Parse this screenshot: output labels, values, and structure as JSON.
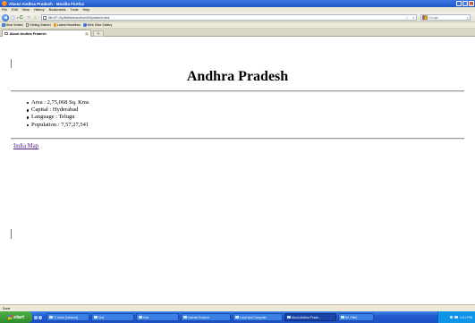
{
  "window": {
    "title": "About Andhra Pradesh - Mozilla Firefox",
    "minimize_label": "_",
    "maximize_label": "□",
    "close_label": "×"
  },
  "menu": [
    "File",
    "Edit",
    "View",
    "History",
    "Bookmarks",
    "Tools",
    "Help"
  ],
  "nav": {
    "back_glyph": "◀",
    "forward_glyph": "▶",
    "dropdown_glyph": "▾",
    "reload_glyph": "C",
    "stop_glyph": "✕",
    "home_glyph": "⌂",
    "url": "file:///F:/Ap/IM/html/andhra%20pradesh.html",
    "bookmark_star": "☆",
    "search_placeholder": "Google",
    "search_glyph": "⌕"
  },
  "bookmarks": [
    {
      "label": "Most Visited",
      "icon": "blue"
    },
    {
      "label": "Getting Started",
      "icon": "page"
    },
    {
      "label": "Latest Headlines",
      "icon": "rss"
    },
    {
      "label": "Web Slice Gallery",
      "icon": "ie"
    }
  ],
  "tab": {
    "title": "About Andhra Pradesh",
    "close_glyph": "×",
    "newtab_glyph": "+"
  },
  "page": {
    "heading": "Andhra Pradesh",
    "facts": [
      "Area : 2,75,068 Sq. Kms",
      "Capital : Hyderabad",
      "Language : Telugu",
      "Population : 7,57,27,541"
    ],
    "map_link": "India Map"
  },
  "status": {
    "text": "Done"
  },
  "taskbar": {
    "start_label": "start",
    "tasks": [
      {
        "label": "Y! Inbox (Inbound)",
        "active": false
      },
      {
        "label": "html",
        "active": false
      },
      {
        "label": "html",
        "active": false
      },
      {
        "label": "Internet Explorer",
        "active": false
      },
      {
        "label": "Local and Computer",
        "active": false
      },
      {
        "label": "About Andhra Prade...",
        "active": true
      },
      {
        "label": "Mr. Paint",
        "active": false
      }
    ],
    "clock": "1:21 PM"
  }
}
